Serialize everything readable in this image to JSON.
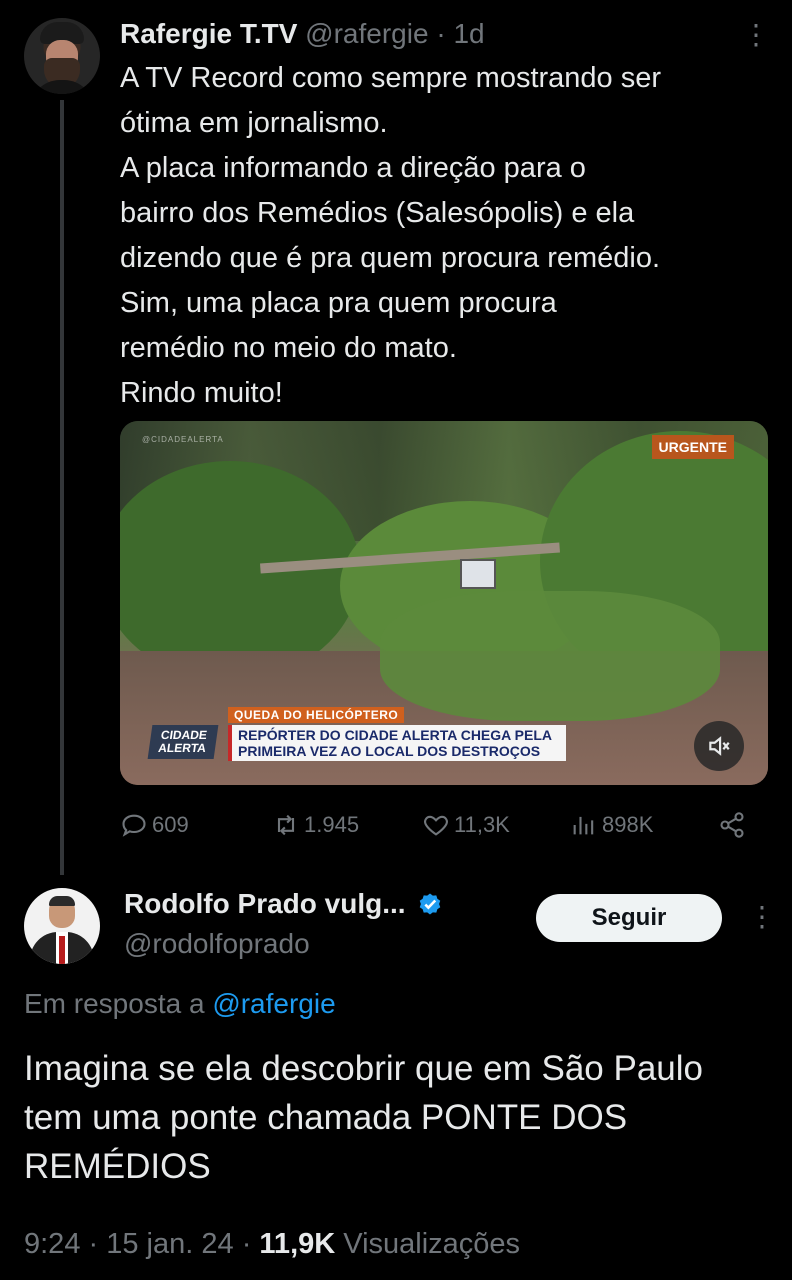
{
  "tweet": {
    "author_name": "Rafergie T.TV",
    "handle": "@rafergie",
    "separator": "·",
    "time_ago": "1d",
    "more_icon": "more-vertical-icon",
    "lines": [
      "A TV Record como sempre mostrando ser",
      "ótima em jornalismo.",
      "A placa informando a direção para o",
      "bairro dos Remédios (Salesópolis) e ela",
      "dizendo que é pra quem procura remédio.",
      "Sim, uma placa pra quem procura",
      "remédio no meio do mato.",
      "Rindo muito!"
    ],
    "media": {
      "watermark": "@CIDADEALERTA",
      "badge": "URGENTE",
      "tag": "QUEDA DO HELICÓPTERO",
      "logo": "CIDADE ALERTA",
      "headline_line1": "REPÓRTER DO CIDADE ALERTA CHEGA PELA",
      "headline_line2": "PRIMEIRA VEZ AO LOCAL DOS DESTROÇOS",
      "mute_icon": "volume-muted-icon"
    },
    "stats": {
      "replies": "609",
      "retweets": "1.945",
      "likes": "11,3K",
      "views": "898K"
    }
  },
  "reply": {
    "author_name": "Rodolfo Prado vulg...",
    "handle": "@rodolfoprado",
    "follow_label": "Seguir",
    "replying_prefix": "Em resposta a",
    "replying_to": "@rafergie",
    "text": "Imagina se ela descobrir que em São Paulo tem uma ponte chamada PONTE DOS REMÉDIOS",
    "time": "9:24",
    "date": "15 jan. 24",
    "views_count": "11,9K",
    "views_label": "Visualizações",
    "accent": "#1d9bf0"
  }
}
